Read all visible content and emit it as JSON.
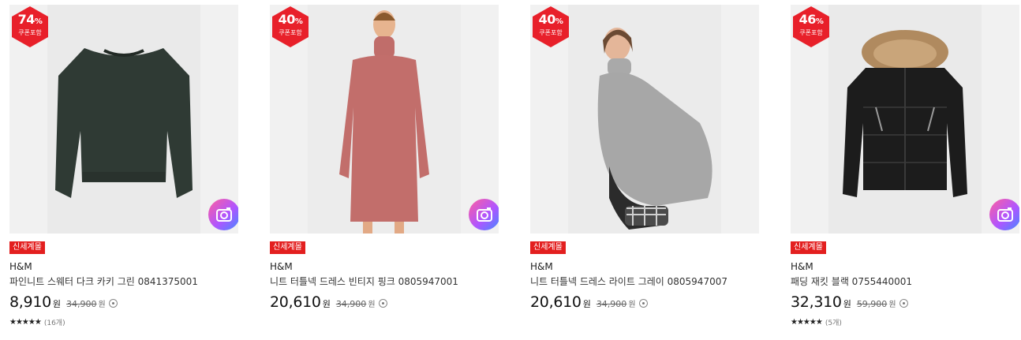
{
  "products": [
    {
      "discount": "74",
      "pct_sign": "%",
      "coupon": "쿠폰포함",
      "tag": "신세계몰",
      "brand": "H&M",
      "name": "파인니트 스웨터 다크 카키 그린 0841375001",
      "price": "8,910",
      "won": "원",
      "original": "34,900",
      "won2": "원",
      "stars": "★★★★★",
      "reviews": "(16개)"
    },
    {
      "discount": "40",
      "pct_sign": "%",
      "coupon": "쿠폰포함",
      "tag": "신세계몰",
      "brand": "H&M",
      "name": "니트 터틀넥 드레스 빈티지 핑크 0805947001",
      "price": "20,610",
      "won": "원",
      "original": "34,900",
      "won2": "원"
    },
    {
      "discount": "40",
      "pct_sign": "%",
      "coupon": "쿠폰포함",
      "tag": "신세계몰",
      "brand": "H&M",
      "name": "니트 터틀넥 드레스 라이트 그레이 0805947007",
      "price": "20,610",
      "won": "원",
      "original": "34,900",
      "won2": "원"
    },
    {
      "discount": "46",
      "pct_sign": "%",
      "coupon": "쿠폰포함",
      "tag": "신세계몰",
      "brand": "H&M",
      "name": "패딩 재킷 블랙 0755440001",
      "price": "32,310",
      "won": "원",
      "original": "59,900",
      "won2": "원",
      "stars": "★★★★★",
      "reviews": "(5개)"
    }
  ],
  "colors": {
    "discount_badge": "#e8202a",
    "tag": "#e31f1f",
    "camera_gradient": [
      "#ff5f9e",
      "#b055ff",
      "#3f8bff"
    ]
  },
  "icons": {
    "camera": "camera-search-icon",
    "info": "info-icon",
    "badge": "discount-hexagon-icon"
  }
}
